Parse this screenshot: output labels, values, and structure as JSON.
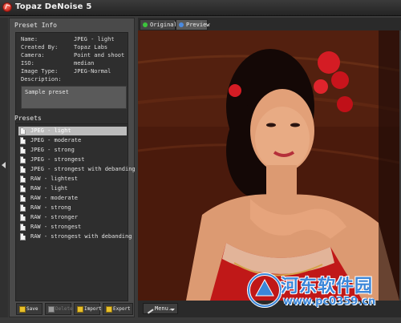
{
  "window": {
    "title": "Topaz DeNoise 5"
  },
  "preset_info": {
    "heading": "Preset Info",
    "rows": [
      {
        "key": "Name:",
        "value": "JPEG - light"
      },
      {
        "key": "Created By:",
        "value": "Topaz Labs"
      },
      {
        "key": "Camera:",
        "value": "Point and shoot"
      },
      {
        "key": "ISO:",
        "value": "median"
      },
      {
        "key": "Image Type:",
        "value": "JPEG-Normal"
      },
      {
        "key": "Description:",
        "value": ""
      }
    ],
    "description": "Sample preset"
  },
  "presets": {
    "heading": "Presets",
    "selected_index": 0,
    "items": [
      "JPEG - light",
      "JPEG - moderate",
      "JPEG - strong",
      "JPEG - strongest",
      "JPEG - strongest with debanding",
      "RAW - lightest",
      "RAW - light",
      "RAW - moderate",
      "RAW - strong",
      "RAW - stronger",
      "RAW - strongest",
      "RAW - strongest with debanding"
    ],
    "buttons": [
      {
        "label": "Save",
        "enabled": true
      },
      {
        "label": "Delete",
        "enabled": false
      },
      {
        "label": "Import",
        "enabled": true
      },
      {
        "label": "Export",
        "enabled": true
      }
    ]
  },
  "view_tabs": [
    {
      "label": "Original",
      "dot_color": "#3cc43c",
      "active": false
    },
    {
      "label": "Preview",
      "dot_color": "#4a8ae0",
      "active": true
    }
  ],
  "bottom_bar": {
    "menu_label": "Menu.."
  },
  "watermark": {
    "text": "河东软件园",
    "url": "www.pc0359.cn"
  },
  "colors": {
    "accent_logo": "#3b86d8",
    "selected_row": "#bcbcbc"
  }
}
